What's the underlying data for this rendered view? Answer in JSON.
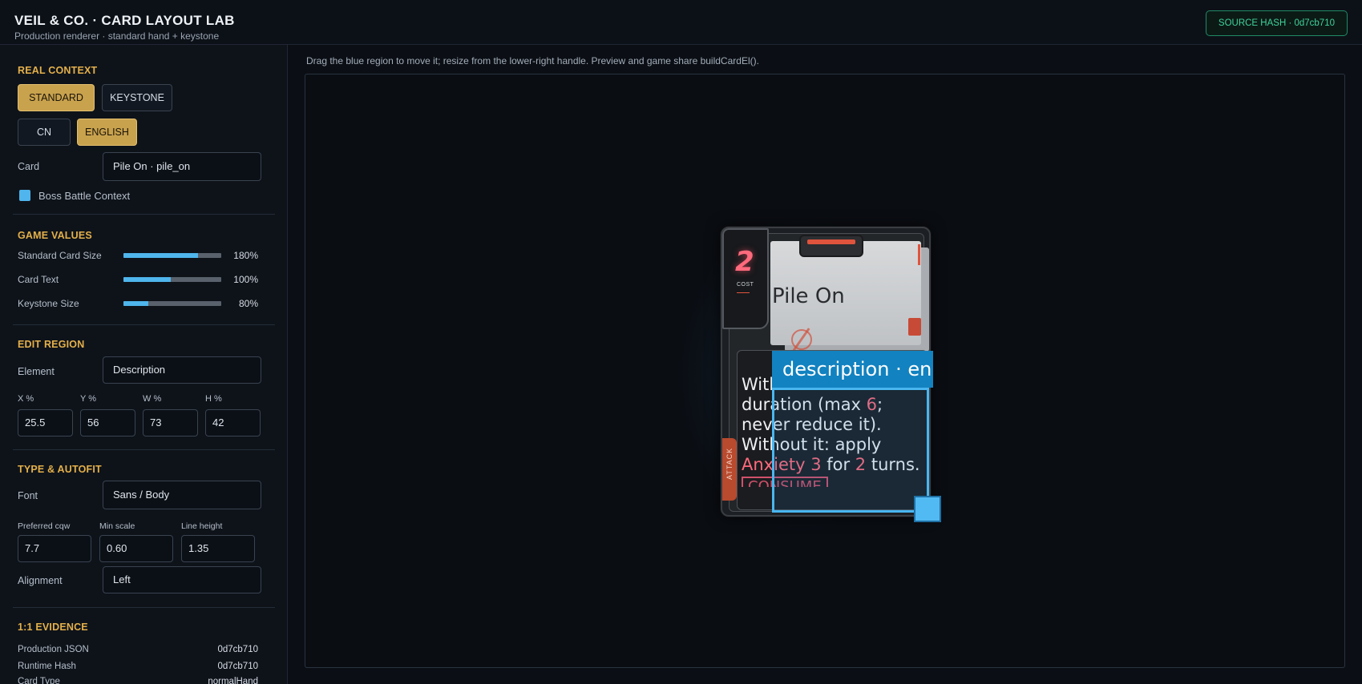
{
  "header": {
    "title": "VEIL & CO. · CARD LAYOUT LAB",
    "subtitle": "Production renderer · standard hand + keystone",
    "hash_badge": "SOURCE HASH · 0d7cb710"
  },
  "real_context": {
    "title": "REAL CONTEXT",
    "mode_buttons": [
      {
        "label": "STANDARD",
        "active": true
      },
      {
        "label": "KEYSTONE",
        "active": false
      }
    ],
    "lang_buttons": [
      {
        "label": "CN",
        "active": false
      },
      {
        "label": "ENGLISH",
        "active": true
      }
    ],
    "card_label": "Card",
    "card_value": "Pile On · pile_on",
    "boss_label": "Boss Battle Context",
    "boss_checked": true
  },
  "game_values": {
    "title": "GAME VALUES",
    "sliders": [
      {
        "label": "Standard Card Size",
        "value": "180%",
        "fraction": 0.76
      },
      {
        "label": "Card Text",
        "value": "100%",
        "fraction": 0.48
      },
      {
        "label": "Keystone Size",
        "value": "80%",
        "fraction": 0.25
      }
    ]
  },
  "edit_region": {
    "title": "EDIT REGION",
    "element_label": "Element",
    "element_value": "Description",
    "x_label": "X %",
    "x_value": "25.5",
    "y_label": "Y %",
    "y_value": "56",
    "w_label": "W %",
    "w_value": "73",
    "h_label": "H %",
    "h_value": "42"
  },
  "type_autofit": {
    "title": "TYPE & AUTOFIT",
    "font_label": "Font",
    "font_value": "Sans / Body",
    "cqw_label": "Preferred cqw",
    "cqw_value": "7.7",
    "min_scale_label": "Min scale",
    "min_scale_value": "0.60",
    "line_height_label": "Line height",
    "line_height_value": "1.35",
    "alignment_label": "Alignment",
    "alignment_value": "Left"
  },
  "evidence": {
    "title": "1:1 EVIDENCE",
    "rows": [
      {
        "label": "Production JSON",
        "value": "0d7cb710"
      },
      {
        "label": "Runtime Hash",
        "value": "0d7cb710"
      },
      {
        "label": "Card Type",
        "value": "normalHand"
      }
    ]
  },
  "main": {
    "hint": "Drag the blue region to move it; resize from the lower-right handle. Preview and game share buildCardEl().",
    "selection_tag": "description · en"
  },
  "card": {
    "cost": "2",
    "cost_label": "COST",
    "name": "Pile On",
    "type_label": "ATTACK",
    "desc_part1": "With",
    "desc_part2": "duration (max ",
    "desc_max": "6",
    "desc_part3": "; never reduce it).",
    "desc_part4": "Without it: apply",
    "desc_status": "Anxiety 3",
    "desc_part5": " for ",
    "desc_turns": "2",
    "desc_part6": " turns.",
    "consume": "CONSUME"
  },
  "colors": {
    "accent_gold": "#c9a24e",
    "accent_blue": "#4fb5ec",
    "hash_green": "#3fd39a",
    "highlight_red": "#ff6a7c"
  }
}
